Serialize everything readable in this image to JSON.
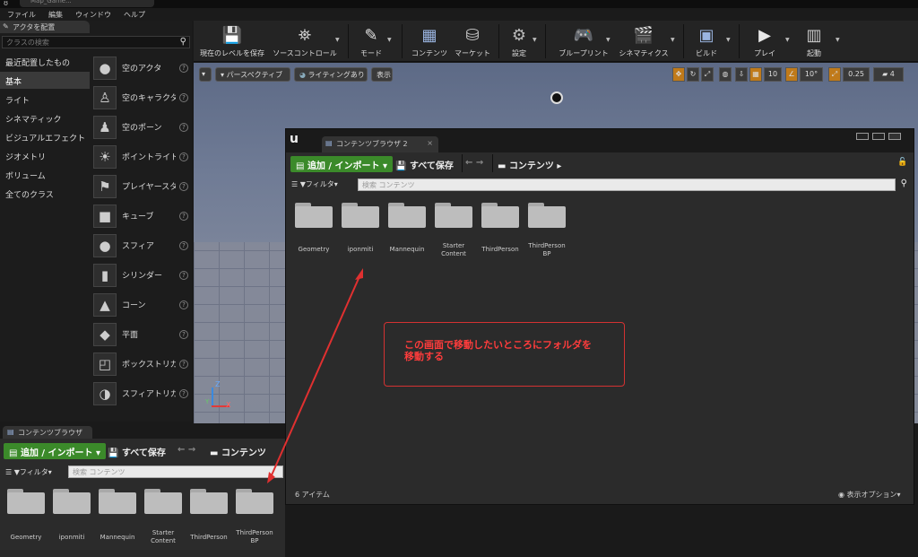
{
  "title_tab": "Map_Game...",
  "menu": [
    "ファイル",
    "編集",
    "ウィンドウ",
    "ヘルプ"
  ],
  "place_panel": {
    "header": "アクタを配置",
    "search_placeholder": "クラスの検索",
    "categories": [
      "最近配置したもの",
      "基本",
      "ライト",
      "シネマティック",
      "ビジュアルエフェクト",
      "ジオメトリ",
      "ボリューム",
      "全てのクラス"
    ],
    "selected_category": "基本",
    "actors": [
      "空のアクタ",
      "空のキャラクタ",
      "空のポーン",
      "ポイントライト",
      "プレイヤースタ",
      "キューブ",
      "スフィア",
      "シリンダー",
      "コーン",
      "平面",
      "ボックストリガ",
      "スフィアトリガ"
    ]
  },
  "toolbar": [
    {
      "label": "現在のレベルを保存",
      "icon": "save-icon"
    },
    {
      "label": "ソースコントロール",
      "icon": "source-control-icon"
    },
    {
      "label": "モード",
      "icon": "modes-icon"
    },
    {
      "label": "コンテンツ",
      "icon": "content-icon"
    },
    {
      "label": "マーケット",
      "icon": "marketplace-icon"
    },
    {
      "label": "設定",
      "icon": "settings-icon"
    },
    {
      "label": "ブループリント",
      "icon": "blueprint-icon"
    },
    {
      "label": "シネマティクス",
      "icon": "cinematics-icon"
    },
    {
      "label": "ビルド",
      "icon": "build-icon"
    },
    {
      "label": "プレイ",
      "icon": "play-icon"
    },
    {
      "label": "起動",
      "icon": "launch-icon"
    }
  ],
  "viewport": {
    "perspective": "パースペクティブ",
    "lighting": "ライティングあり",
    "show": "表示",
    "grid_snap": "10",
    "rot_snap": "10°",
    "scale_snap": "0.25",
    "cam_speed": "4",
    "axis_x": "X",
    "axis_y": "Y",
    "axis_z": "Z"
  },
  "content_browser_2": {
    "tab": "コンテンツブラウザ 2",
    "add_import": "追加 / インポート",
    "save_all": "すべて保存",
    "path": "コンテンツ",
    "filter": "フィルタ",
    "search_placeholder": "検索 コンテンツ",
    "folders": [
      "Geometry",
      "iponmiti",
      "Mannequin",
      "Starter\nContent",
      "ThirdPerson",
      "ThirdPerson\nBP"
    ],
    "item_count": "6 アイテム",
    "view_options": "表示オプション"
  },
  "content_browser_1": {
    "tab": "コンテンツブラウザ",
    "add_import": "追加 / インポート",
    "save_all": "すべて保存",
    "path": "コンテンツ",
    "filter": "フィルタ",
    "search_placeholder": "検索 コンテンツ",
    "folders": [
      "Geometry",
      "iponmiti",
      "Mannequin",
      "Starter\nContent",
      "ThirdPerson",
      "ThirdPerson\nBP"
    ]
  },
  "annotation": "この画面で移動したいところにフォルダを\n移動する",
  "colors": {
    "accent_green": "#3b8a2a",
    "annotation_red": "#e03030"
  }
}
